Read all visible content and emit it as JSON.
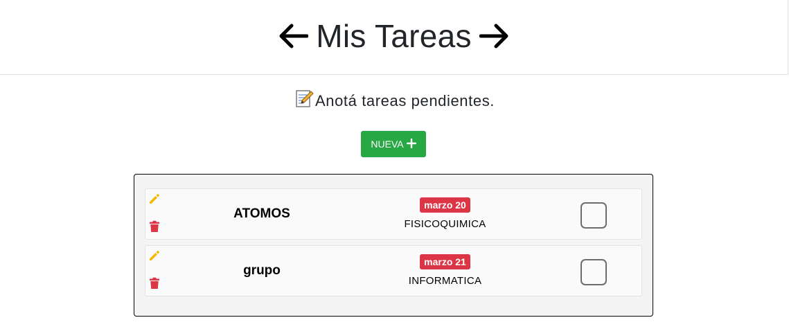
{
  "header": {
    "title": "Mis Tareas",
    "prev_icon": "arrow-left-icon",
    "next_icon": "arrow-right-icon"
  },
  "subtitle": {
    "icon": "memo-icon",
    "text": "Anotá tareas pendientes."
  },
  "new_button": {
    "label": "NUEVA",
    "icon": "plus-icon",
    "color": "#28a745"
  },
  "tasks": [
    {
      "name": "ATOMOS",
      "date": "marzo 20",
      "subject": "FISICOQUIMICA",
      "done": false
    },
    {
      "name": "grupo",
      "date": "marzo 21",
      "subject": "INFORMATICA",
      "done": false
    }
  ],
  "colors": {
    "edit_icon": "#f5b800",
    "delete_icon": "#dc3545",
    "date_badge": "#dc3545"
  }
}
